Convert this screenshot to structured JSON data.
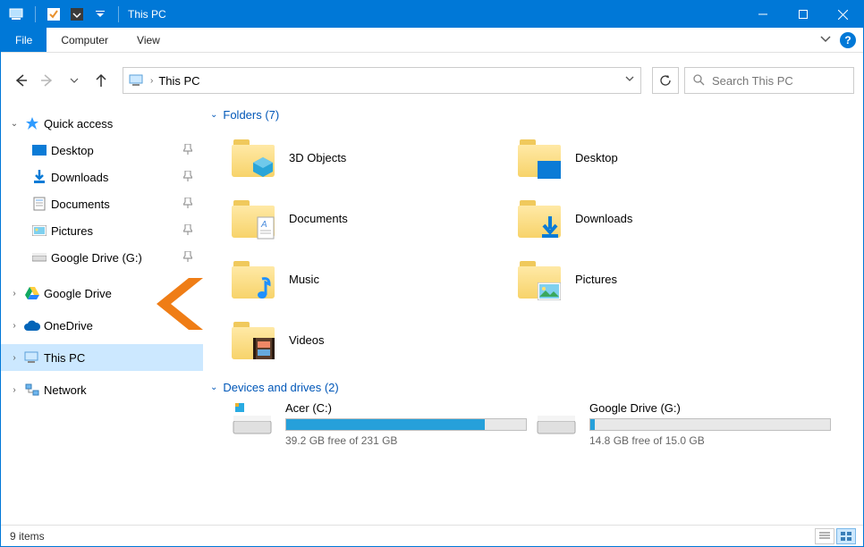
{
  "window": {
    "title": "This PC"
  },
  "ribbon": {
    "file": "File",
    "tabs": [
      "Computer",
      "View"
    ]
  },
  "nav": {
    "breadcrumb": "This PC",
    "search_placeholder": "Search This PC"
  },
  "tree": {
    "quick_access": "Quick access",
    "qa_items": [
      {
        "label": "Desktop"
      },
      {
        "label": "Downloads"
      },
      {
        "label": "Documents"
      },
      {
        "label": "Pictures"
      },
      {
        "label": "Google Drive (G:)"
      }
    ],
    "nodes": [
      {
        "label": "Google Drive"
      },
      {
        "label": "OneDrive"
      },
      {
        "label": "This PC"
      },
      {
        "label": "Network"
      }
    ]
  },
  "groups": {
    "folders_header": "Folders (7)",
    "drives_header": "Devices and drives (2)"
  },
  "folders": [
    {
      "label": "3D Objects"
    },
    {
      "label": "Desktop"
    },
    {
      "label": "Documents"
    },
    {
      "label": "Downloads"
    },
    {
      "label": "Music"
    },
    {
      "label": "Pictures"
    },
    {
      "label": "Videos"
    }
  ],
  "drives": [
    {
      "label": "Acer (C:)",
      "free_text": "39.2 GB free of 231 GB",
      "fill_pct": 83
    },
    {
      "label": "Google Drive (G:)",
      "free_text": "14.8 GB free of 15.0 GB",
      "fill_pct": 2
    }
  ],
  "status": {
    "items": "9 items"
  }
}
